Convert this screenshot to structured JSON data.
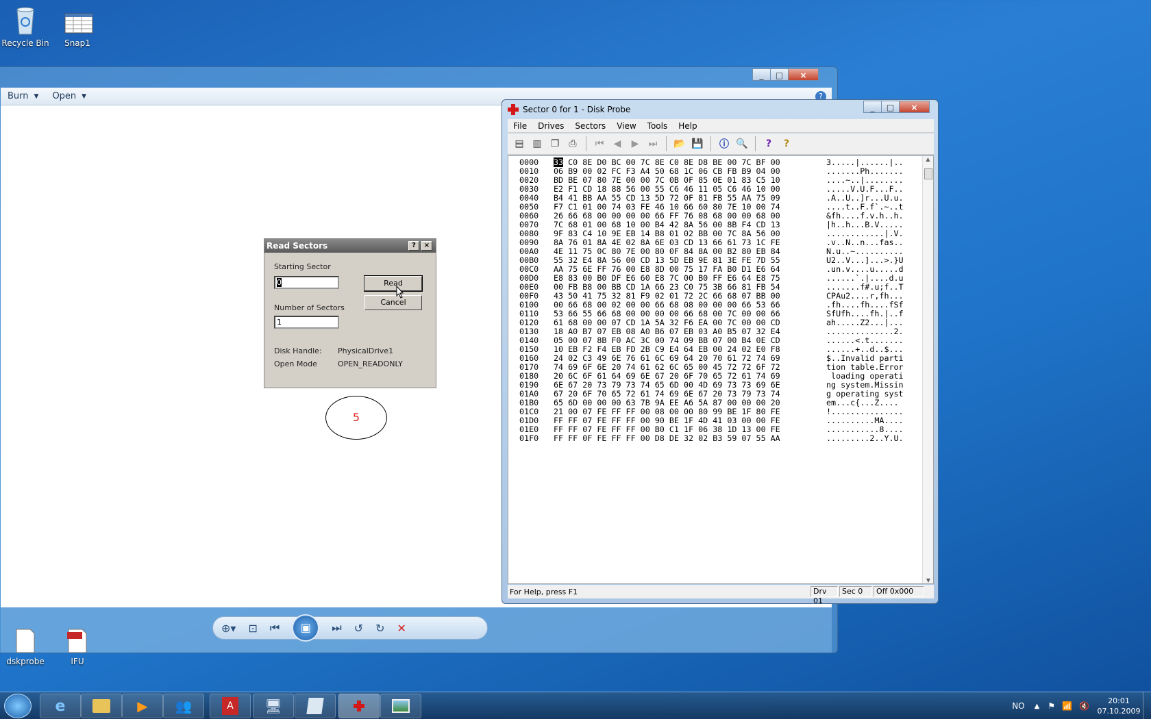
{
  "desktop": {
    "icons": [
      {
        "label": "Recycle Bin"
      },
      {
        "label": "Snap1"
      },
      {
        "label": "dskprobe"
      },
      {
        "label": "IFU"
      }
    ]
  },
  "viewer": {
    "menu": {
      "burn": "Burn",
      "open": "Open"
    },
    "ellipse_text": "5"
  },
  "read_dialog": {
    "title": "Read Sectors",
    "help_btn": "?",
    "close_btn": "×",
    "starting_sector_label": "Starting Sector",
    "starting_sector_value": "0",
    "number_of_sectors_label": "Number of Sectors",
    "number_of_sectors_value": "1",
    "read_btn": "Read",
    "cancel_btn": "Cancel",
    "disk_handle_label": "Disk Handle:",
    "disk_handle_value": "PhysicalDrive1",
    "open_mode_label": "Open Mode",
    "open_mode_value": "OPEN_READONLY"
  },
  "probe": {
    "title": "Sector 0 for 1 - Disk Probe",
    "menu": [
      "File",
      "Drives",
      "Sectors",
      "View",
      "Tools",
      "Help"
    ],
    "status": {
      "help": "For Help, press F1",
      "drv": "Drv  01",
      "sec": "Sec 0",
      "off": "Off 0x000"
    },
    "hex": [
      {
        "off": "0000",
        "hex": "33 C0 8E D0 BC 00 7C 8E C0 8E D8 BE 00 7C BF 00",
        "ascii": "3.....|......|.."
      },
      {
        "off": "0010",
        "hex": "06 B9 00 02 FC F3 A4 50 68 1C 06 CB FB B9 04 00",
        "ascii": ".......Ph......."
      },
      {
        "off": "0020",
        "hex": "BD BE 07 80 7E 00 00 7C 0B 0F 85 0E 01 83 C5 10",
        "ascii": "....~..|........"
      },
      {
        "off": "0030",
        "hex": "E2 F1 CD 18 88 56 00 55 C6 46 11 05 C6 46 10 00",
        "ascii": ".....V.U.F...F.."
      },
      {
        "off": "0040",
        "hex": "B4 41 BB AA 55 CD 13 5D 72 0F 81 FB 55 AA 75 09",
        "ascii": ".A..U..]r...U.u."
      },
      {
        "off": "0050",
        "hex": "F7 C1 01 00 74 03 FE 46 10 66 60 80 7E 10 00 74",
        "ascii": "....t..F.f`.~..t"
      },
      {
        "off": "0060",
        "hex": "26 66 68 00 00 00 00 66 FF 76 08 68 00 00 68 00",
        "ascii": "&fh....f.v.h..h."
      },
      {
        "off": "0070",
        "hex": "7C 68 01 00 68 10 00 B4 42 8A 56 00 8B F4 CD 13",
        "ascii": "|h..h...B.V....."
      },
      {
        "off": "0080",
        "hex": "9F 83 C4 10 9E EB 14 B8 01 02 BB 00 7C 8A 56 00",
        "ascii": "............|.V."
      },
      {
        "off": "0090",
        "hex": "8A 76 01 8A 4E 02 8A 6E 03 CD 13 66 61 73 1C FE",
        "ascii": ".v..N..n...fas.."
      },
      {
        "off": "00A0",
        "hex": "4E 11 75 0C 80 7E 00 80 0F 84 8A 00 B2 80 EB 84",
        "ascii": "N.u..~.........."
      },
      {
        "off": "00B0",
        "hex": "55 32 E4 8A 56 00 CD 13 5D EB 9E 81 3E FE 7D 55",
        "ascii": "U2..V...]...>.}U"
      },
      {
        "off": "00C0",
        "hex": "AA 75 6E FF 76 00 E8 8D 00 75 17 FA B0 D1 E6 64",
        "ascii": ".un.v....u.....d"
      },
      {
        "off": "00D0",
        "hex": "E8 83 00 B0 DF E6 60 E8 7C 00 B0 FF E6 64 E8 75",
        "ascii": "......`.|....d.u"
      },
      {
        "off": "00E0",
        "hex": "00 FB B8 00 BB CD 1A 66 23 C0 75 3B 66 81 FB 54",
        "ascii": ".......f#.u;f..T"
      },
      {
        "off": "00F0",
        "hex": "43 50 41 75 32 81 F9 02 01 72 2C 66 68 07 BB 00",
        "ascii": "CPAu2....r,fh..."
      },
      {
        "off": "0100",
        "hex": "00 66 68 00 02 00 00 66 68 08 00 00 00 66 53 66",
        "ascii": ".fh....fh....fSf"
      },
      {
        "off": "0110",
        "hex": "53 66 55 66 68 00 00 00 00 66 68 00 7C 00 00 66",
        "ascii": "SfUfh....fh.|..f"
      },
      {
        "off": "0120",
        "hex": "61 68 00 00 07 CD 1A 5A 32 F6 EA 00 7C 00 00 CD",
        "ascii": "ah.....Z2...|..."
      },
      {
        "off": "0130",
        "hex": "18 A0 B7 07 EB 08 A0 B6 07 EB 03 A0 B5 07 32 E4",
        "ascii": "..............2."
      },
      {
        "off": "0140",
        "hex": "05 00 07 8B F0 AC 3C 00 74 09 BB 07 00 B4 0E CD",
        "ascii": "......<.t......."
      },
      {
        "off": "0150",
        "hex": "10 EB F2 F4 EB FD 2B C9 E4 64 EB 00 24 02 E0 F8",
        "ascii": "......+..d..$..."
      },
      {
        "off": "0160",
        "hex": "24 02 C3 49 6E 76 61 6C 69 64 20 70 61 72 74 69",
        "ascii": "$..Invalid parti"
      },
      {
        "off": "0170",
        "hex": "74 69 6F 6E 20 74 61 62 6C 65 00 45 72 72 6F 72",
        "ascii": "tion table.Error"
      },
      {
        "off": "0180",
        "hex": "20 6C 6F 61 64 69 6E 67 20 6F 70 65 72 61 74 69",
        "ascii": " loading operati"
      },
      {
        "off": "0190",
        "hex": "6E 67 20 73 79 73 74 65 6D 00 4D 69 73 73 69 6E",
        "ascii": "ng system.Missin"
      },
      {
        "off": "01A0",
        "hex": "67 20 6F 70 65 72 61 74 69 6E 67 20 73 79 73 74",
        "ascii": "g operating syst"
      },
      {
        "off": "01B0",
        "hex": "65 6D 00 00 00 63 7B 9A EE A6 5A 87 00 00 00 20",
        "ascii": "em...c{...Z...."
      },
      {
        "off": "01C0",
        "hex": "21 00 07 FE FF FF 00 08 00 00 80 99 BE 1F 80 FE",
        "ascii": "!..............."
      },
      {
        "off": "01D0",
        "hex": "FF FF 07 FE FF FF 00 90 BE 1F 4D 41 03 00 00 FE",
        "ascii": "..........MA...."
      },
      {
        "off": "01E0",
        "hex": "FF FF 07 FE FF FF 00 B0 C1 1F 06 38 1D 13 00 FE",
        "ascii": "...........8...."
      },
      {
        "off": "01F0",
        "hex": "FF FF 0F FE FF FF 00 D8 DE 32 02 B3 59 07 55 AA",
        "ascii": ".........2..Y.U."
      }
    ]
  },
  "tray": {
    "lang": "NO",
    "time": "20:01",
    "date": "07.10.2009"
  }
}
